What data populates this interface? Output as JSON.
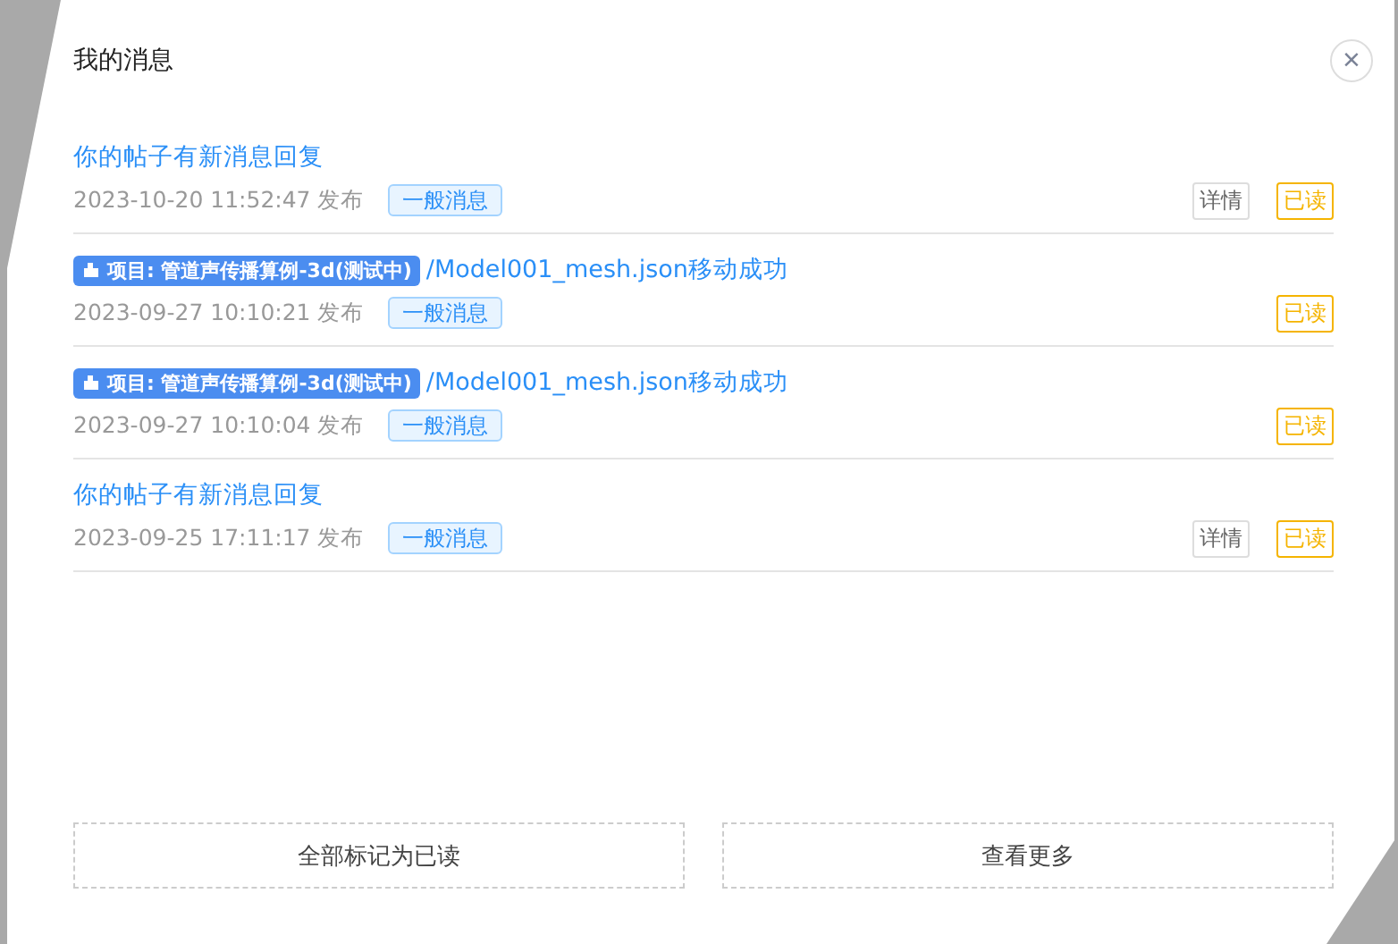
{
  "dialog": {
    "title": "我的消息",
    "close": "×"
  },
  "messages": [
    {
      "kind": "reply",
      "title": "你的帖子有新消息回复",
      "time": "2023-10-20 11:52:47 发布",
      "category": "一般消息",
      "details": "详情",
      "read": "已读"
    },
    {
      "kind": "project",
      "project_tag": "项目: 管道声传播算例-3d(测试中)",
      "title": "/Model001_mesh.json移动成功",
      "time": "2023-09-27 10:10:21 发布",
      "category": "一般消息",
      "read": "已读"
    },
    {
      "kind": "project",
      "project_tag": "项目: 管道声传播算例-3d(测试中)",
      "title": "/Model001_mesh.json移动成功",
      "time": "2023-09-27 10:10:04 发布",
      "category": "一般消息",
      "read": "已读"
    },
    {
      "kind": "reply",
      "title": "你的帖子有新消息回复",
      "time": "2023-09-25 17:11:17 发布",
      "category": "一般消息",
      "details": "详情",
      "read": "已读"
    }
  ],
  "footer_buttons": [
    "全部标记为已读",
    "查看更多"
  ]
}
